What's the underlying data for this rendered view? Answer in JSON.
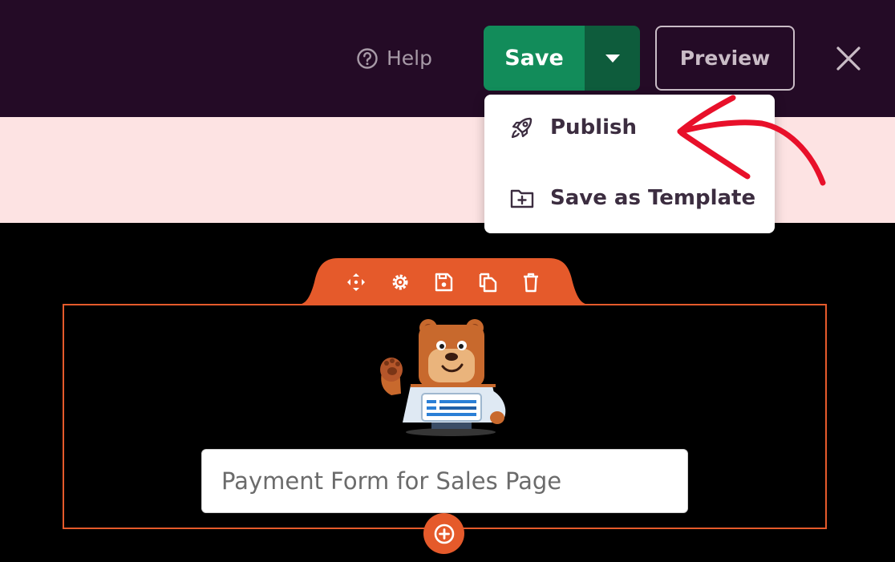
{
  "header": {
    "help_label": "Help",
    "save_label": "Save",
    "preview_label": "Preview"
  },
  "save_menu": {
    "items": [
      {
        "label": "Publish",
        "icon": "rocket-icon"
      },
      {
        "label": "Save as Template",
        "icon": "folder-plus-icon"
      }
    ]
  },
  "section_toolbar": {
    "icons": [
      "move-icon",
      "gear-icon",
      "save-icon",
      "duplicate-icon",
      "trash-icon"
    ]
  },
  "form": {
    "title_value": "Payment Form for Sales Page"
  },
  "colors": {
    "topbar": "#240b26",
    "save_green": "#128c5a",
    "save_dark": "#0e5c3c",
    "notice_pink": "#fde3e3",
    "accent_orange": "#e55a2b",
    "annotation_red": "#e8102a"
  }
}
